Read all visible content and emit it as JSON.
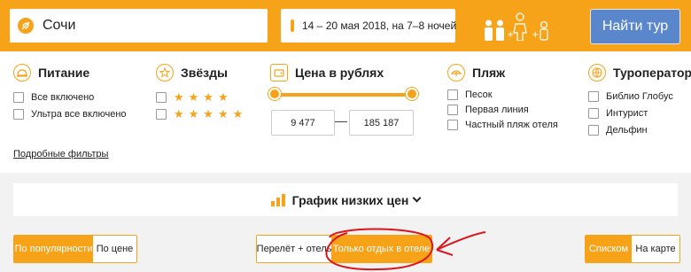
{
  "search": {
    "city": "Сочи",
    "dates": "14 – 20 мая 2018, на 7–8 ночей",
    "find_button": "Найти тур"
  },
  "filters": {
    "food": {
      "title": "Питание",
      "options": [
        "Все включено",
        "Ультра все включено"
      ]
    },
    "stars": {
      "title": "Звёзды",
      "options": [
        "★★★★",
        "★★★★★"
      ]
    },
    "price": {
      "title": "Цена в рублях",
      "min": "9 477",
      "max": "185 187"
    },
    "beach": {
      "title": "Пляж",
      "options": [
        "Песок",
        "Первая линия",
        "Частный пляж отеля"
      ]
    },
    "operators": {
      "title": "Туроператоры",
      "options": [
        "Библио Глобус",
        "Интурист",
        "Дельфин"
      ]
    },
    "detailed_link": "Подробные фильтры"
  },
  "low_price_chart": {
    "label": "График низких цен"
  },
  "sort": {
    "popular": "По популярности",
    "price": "По цене"
  },
  "mode": {
    "flight_hotel": "Перелёт + отель",
    "hotel_only": "Только отдых в отеле"
  },
  "view": {
    "list": "Списком",
    "map": "На карте"
  },
  "colors": {
    "accent": "#f7a31a",
    "button": "#5a86cc",
    "annotation": "#d9161c"
  }
}
